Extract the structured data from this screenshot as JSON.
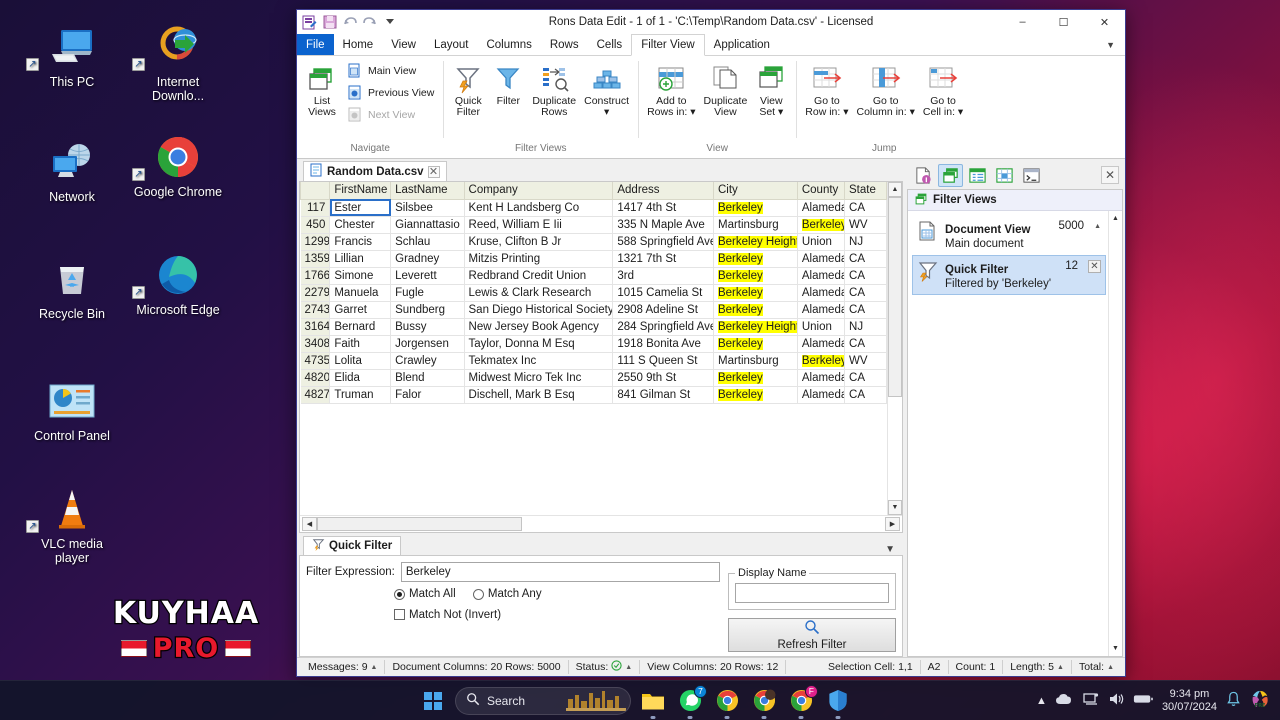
{
  "desktop": {
    "icons": [
      {
        "name": "This PC",
        "icon": "this-pc-icon"
      },
      {
        "name": "Internet Downlo...",
        "icon": "internet-download-manager-icon"
      },
      {
        "name": "Network",
        "icon": "network-icon"
      },
      {
        "name": "Google Chrome",
        "icon": "google-chrome-icon"
      },
      {
        "name": "Recycle Bin",
        "icon": "recycle-bin-icon"
      },
      {
        "name": "Microsoft Edge",
        "icon": "microsoft-edge-icon"
      },
      {
        "name": "Control Panel",
        "icon": "control-panel-icon"
      },
      {
        "name": "VLC media player",
        "icon": "vlc-media-player-icon"
      }
    ],
    "watermark": {
      "line1": "KUYHAA",
      "line2": "PRO"
    }
  },
  "window": {
    "title": "Rons Data Edit - 1 of 1 - 'C:\\Temp\\Random Data.csv' - Licensed",
    "quick_access": [
      "app-icon",
      "save-icon",
      "undo-icon",
      "redo-icon",
      "customize-icon"
    ],
    "controls": {
      "minimize": "–",
      "maximize": "☐",
      "close": "✕"
    }
  },
  "tabs": {
    "items": [
      "File",
      "Home",
      "View",
      "Layout",
      "Columns",
      "Rows",
      "Cells",
      "Filter View",
      "Application"
    ],
    "active": "Filter View",
    "collapse_icon": "chevron-down-icon"
  },
  "ribbon": {
    "groups": [
      {
        "label": "Navigate",
        "big": [
          {
            "caption1": "List",
            "caption2": "Views",
            "icon": "list-views-icon",
            "disabled": false
          }
        ],
        "small": [
          {
            "caption": "Main View",
            "icon": "main-view-icon",
            "disabled": false
          },
          {
            "caption": "Previous View",
            "icon": "previous-view-icon",
            "disabled": false
          },
          {
            "caption": "Next View",
            "icon": "next-view-icon",
            "disabled": true
          }
        ]
      },
      {
        "label": "Filter Views",
        "big": [
          {
            "caption1": "Quick",
            "caption2": "Filter",
            "icon": "quick-filter-icon",
            "disabled": false
          },
          {
            "caption1": "Filter",
            "caption2": "",
            "icon": "filter-icon",
            "disabled": false
          },
          {
            "caption1": "Duplicate",
            "caption2": "Rows",
            "icon": "duplicate-rows-icon",
            "disabled": false
          },
          {
            "caption1": "Construct",
            "caption2": "▾",
            "icon": "construct-icon",
            "disabled": false
          }
        ],
        "small": []
      },
      {
        "label": "View",
        "big": [
          {
            "caption1": "Add to",
            "caption2": "Rows in: ▾",
            "icon": "add-to-rows-icon",
            "disabled": false
          },
          {
            "caption1": "Duplicate",
            "caption2": "View",
            "icon": "duplicate-view-icon",
            "disabled": false
          },
          {
            "caption1": "View",
            "caption2": "Set ▾",
            "icon": "view-set-icon",
            "disabled": false
          }
        ],
        "small": []
      },
      {
        "label": "Jump",
        "big": [
          {
            "caption1": "Go to",
            "caption2": "Row in: ▾",
            "icon": "go-to-row-icon",
            "disabled": false
          },
          {
            "caption1": "Go to",
            "caption2": "Column in: ▾",
            "icon": "go-to-column-icon",
            "disabled": false
          },
          {
            "caption1": "Go to",
            "caption2": "Cell in: ▾",
            "icon": "go-to-cell-icon",
            "disabled": false
          }
        ],
        "small": []
      }
    ]
  },
  "document": {
    "tab_label": "Random Data.csv",
    "tab_close": "✕",
    "grid": {
      "columns": [
        "",
        "FirstName",
        "LastName",
        "Company",
        "Address",
        "City",
        "County",
        "State"
      ],
      "rows": [
        {
          "id": "117",
          "FirstName": "Ester",
          "LastName": "Silsbee",
          "Company": "Kent H Landsberg Co",
          "Address": "1417 4th St",
          "City": "Berkeley",
          "County": "Alameda",
          "State": "CA",
          "hl": [
            "City"
          ],
          "selected": "FirstName"
        },
        {
          "id": "450",
          "FirstName": "Chester",
          "LastName": "Giannattasio",
          "Company": "Reed, William E Iii",
          "Address": "335 N Maple Ave",
          "City": "Martinsburg",
          "County": "Berkeley",
          "State": "WV",
          "hl": [
            "County"
          ],
          "selected": ""
        },
        {
          "id": "1299",
          "FirstName": "Francis",
          "LastName": "Schlau",
          "Company": "Kruse, Clifton B Jr",
          "Address": "588 Springfield Ave",
          "City": "Berkeley Heights",
          "County": "Union",
          "State": "NJ",
          "hl": [
            "City"
          ],
          "selected": ""
        },
        {
          "id": "1359",
          "FirstName": "Lillian",
          "LastName": "Gradney",
          "Company": "Mitzis Printing",
          "Address": "1321 7th St",
          "City": "Berkeley",
          "County": "Alameda",
          "State": "CA",
          "hl": [
            "City"
          ],
          "selected": ""
        },
        {
          "id": "1766",
          "FirstName": "Simone",
          "LastName": "Leverett",
          "Company": "Redbrand Credit Union",
          "Address": "3rd",
          "City": "Berkeley",
          "County": "Alameda",
          "State": "CA",
          "hl": [
            "City"
          ],
          "selected": ""
        },
        {
          "id": "2279",
          "FirstName": "Manuela",
          "LastName": "Fugle",
          "Company": "Lewis & Clark Research",
          "Address": "1015 Camelia St",
          "City": "Berkeley",
          "County": "Alameda",
          "State": "CA",
          "hl": [
            "City"
          ],
          "selected": ""
        },
        {
          "id": "2743",
          "FirstName": "Garret",
          "LastName": "Sundberg",
          "Company": "San Diego Historical Society",
          "Address": "2908 Adeline St",
          "City": "Berkeley",
          "County": "Alameda",
          "State": "CA",
          "hl": [
            "City"
          ],
          "selected": ""
        },
        {
          "id": "3164",
          "FirstName": "Bernard",
          "LastName": "Bussy",
          "Company": "New Jersey Book Agency",
          "Address": "284 Springfield Ave",
          "City": "Berkeley Heights",
          "County": "Union",
          "State": "NJ",
          "hl": [
            "City"
          ],
          "selected": ""
        },
        {
          "id": "3408",
          "FirstName": "Faith",
          "LastName": "Jorgensen",
          "Company": "Taylor, Donna M Esq",
          "Address": "1918 Bonita Ave",
          "City": "Berkeley",
          "County": "Alameda",
          "State": "CA",
          "hl": [
            "City"
          ],
          "selected": ""
        },
        {
          "id": "4735",
          "FirstName": "Lolita",
          "LastName": "Crawley",
          "Company": "Tekmatex Inc",
          "Address": "111 S Queen St",
          "City": "Martinsburg",
          "County": "Berkeley",
          "State": "WV",
          "hl": [
            "County"
          ],
          "selected": ""
        },
        {
          "id": "4820",
          "FirstName": "Elida",
          "LastName": "Blend",
          "Company": "Midwest Micro Tek Inc",
          "Address": "2550 9th St",
          "City": "Berkeley",
          "County": "Alameda",
          "State": "CA",
          "hl": [
            "City"
          ],
          "selected": ""
        },
        {
          "id": "4827",
          "FirstName": "Truman",
          "LastName": "Falor",
          "Company": "Dischell, Mark B Esq",
          "Address": "841 Gilman St",
          "City": "Berkeley",
          "County": "Alameda",
          "State": "CA",
          "hl": [
            "City"
          ],
          "selected": ""
        }
      ]
    }
  },
  "quick_filter": {
    "tab_label": "Quick Filter",
    "tab_icon": "quick-filter-icon",
    "collapse_icon": "chevron-down-icon",
    "expression_label": "Filter Expression:",
    "expression_value": "Berkeley",
    "expression_placeholder": "",
    "match_all_label": "Match All",
    "match_any_label": "Match Any",
    "match_selected": "Match All",
    "match_not_label": "Match Not (Invert)",
    "match_not_checked": false,
    "display_name_label": "Display Name",
    "display_name_value": "",
    "refresh_label": "Refresh Filter",
    "refresh_icon": "search-icon"
  },
  "filter_views_panel": {
    "toolbar_buttons": [
      "document-info-icon",
      "filter-views-icon",
      "columns-list-icon",
      "cells-grid-icon",
      "console-icon"
    ],
    "active_toolbar_button": "filter-views-icon",
    "close_icon": "✕",
    "header": "Filter Views",
    "header_icon": "filter-views-icon",
    "items": [
      {
        "title": "Document View",
        "subtitle": "Main document",
        "count": "5000",
        "icon": "document-view-icon",
        "selected": false,
        "closable": false,
        "caret": "▲"
      },
      {
        "title": "Quick Filter",
        "subtitle": "Filtered by 'Berkeley'",
        "count": "12",
        "icon": "quick-filter-icon",
        "selected": true,
        "closable": true,
        "close_icon": "✕"
      }
    ]
  },
  "statusbar": {
    "messages": "Messages: 9",
    "document": "Document Columns: 20 Rows: 5000",
    "status_label": "Status:",
    "status_icon": "check-circle-icon",
    "view": "View Columns: 20 Rows: 12",
    "selection": "Selection Cell: 1,1",
    "cell_ref": "A2",
    "count": "Count: 1",
    "length": "Length: 5",
    "total": "Total:"
  },
  "taskbar": {
    "start_icon": "windows-start-icon",
    "search_placeholder": "Search",
    "items": [
      {
        "name": "file-explorer-icon",
        "badge": ""
      },
      {
        "name": "whatsapp-icon",
        "badge": "7"
      },
      {
        "name": "google-chrome-icon",
        "badge": ""
      },
      {
        "name": "chrome-profile-icon",
        "badge": ""
      },
      {
        "name": "chrome-facebook-icon",
        "badge": "F"
      },
      {
        "name": "windows-security-icon",
        "badge": ""
      }
    ],
    "tray": [
      "chevron-up-icon",
      "onedrive-icon",
      "network-icon",
      "volume-icon",
      "battery-icon"
    ],
    "time": "9:34 pm",
    "date": "30/07/2024",
    "notification_icon": "bell-icon",
    "extra_icon": "copilot-icon"
  },
  "colors": {
    "accent": "#0b63ce",
    "highlight": "#ffff00",
    "header_bg": "#eef0e2",
    "selection": "#cfe1f7"
  }
}
